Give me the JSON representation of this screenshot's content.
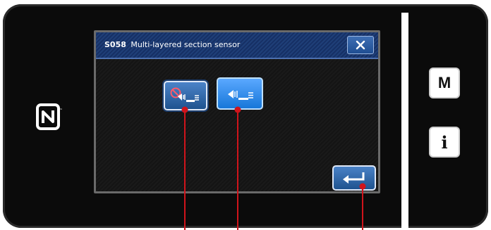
{
  "dialog": {
    "code": "S058",
    "title": "Multi-layered section sensor",
    "close_symbol": "✕"
  },
  "buttons": {
    "sensor_disabled": {
      "icon": "sensor-disabled-icon"
    },
    "sensor_enabled": {
      "icon": "sensor-enabled-icon",
      "selected": true
    },
    "enter": {
      "icon": "enter-icon"
    }
  },
  "side_panel": {
    "menu_label": "M",
    "info_label": "i"
  },
  "logos": {
    "nfc": "nfc-logo"
  },
  "colors": {
    "titlebar": "#1f3f78",
    "button_blue": "#1f538f",
    "button_selected": "#1777d9",
    "callout": "#d0141b"
  }
}
